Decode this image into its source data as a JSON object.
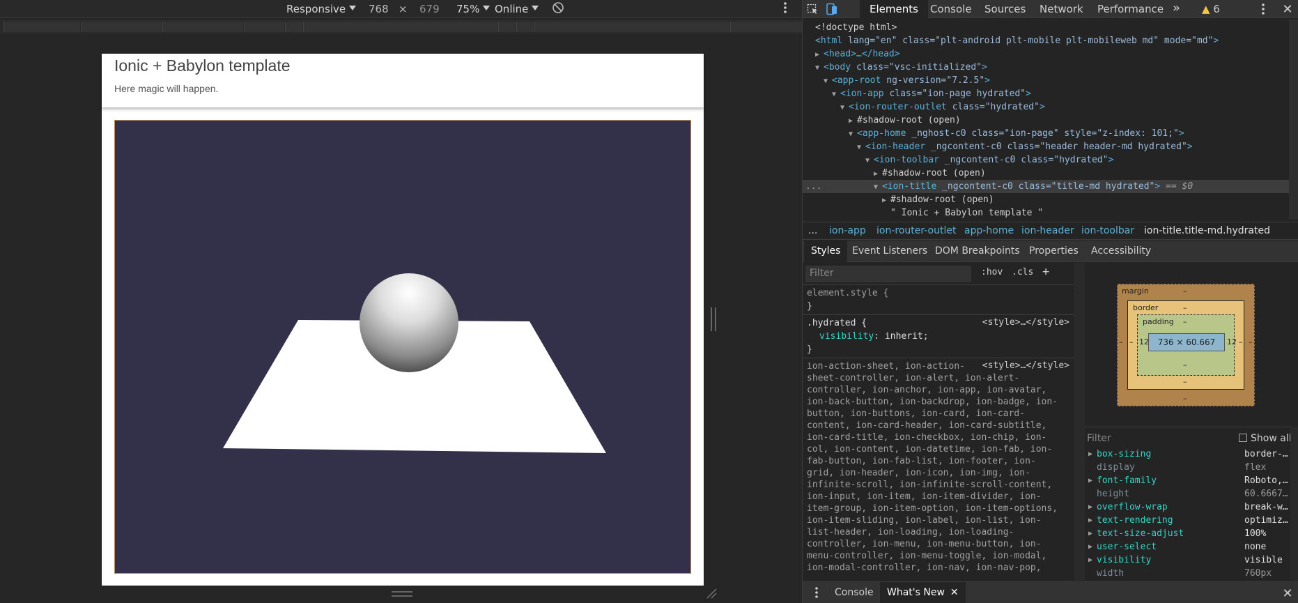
{
  "emulation": {
    "device_label": "Responsive",
    "width_value": "768",
    "times": "×",
    "height_value": "679",
    "zoom_label": "75%",
    "throttle_label": "Online"
  },
  "app": {
    "title": "Ionic + Babylon template",
    "subtitle": "Here magic will happen.",
    "canvas_bg": "#333049"
  },
  "devtools": {
    "tabs": [
      "Elements",
      "Console",
      "Sources",
      "Network",
      "Performance"
    ],
    "more_tabs": "»",
    "warning_count": "6",
    "dom_lines": [
      {
        "text": "<!doctype html>"
      },
      {
        "tag": "html",
        "attrs": "lang=\"en\" class=\"plt-android plt-mobile plt-mobileweb md\" mode=\"md\""
      },
      {
        "tag": "head",
        "text": "<head>…</head>"
      },
      {
        "tag": "body",
        "attrs": "class=\"vsc-initialized\""
      },
      {
        "tag": "app-root",
        "attrs": "ng-version=\"7.2.5\""
      },
      {
        "tag": "ion-app",
        "attrs": "class=\"ion-page hydrated\""
      },
      {
        "tag": "ion-router-outlet",
        "attrs": "class=\"hydrated\""
      },
      {
        "text": "#shadow-root (open)"
      },
      {
        "tag": "app-home",
        "attrs": "_nghost-c0 class=\"ion-page\" style=\"z-index: 101;\""
      },
      {
        "tag": "ion-header",
        "attrs": "_ngcontent-c0 class=\"header header-md hydrated\""
      },
      {
        "tag": "ion-toolbar",
        "attrs": "_ngcontent-c0 class=\"hydrated\""
      },
      {
        "text": "#shadow-root (open)"
      },
      {
        "tag": "ion-title",
        "attrs": "_ngcontent-c0 class=\"title-md hydrated\"",
        "suffix": " == $0"
      },
      {
        "text": "#shadow-root (open)"
      },
      {
        "text": "\" Ionic + Babylon template \""
      }
    ],
    "selected_ellipsis": "...",
    "breadcrumbs": [
      "...",
      "ion-app",
      "ion-router-outlet",
      "app-home",
      "ion-header",
      "ion-toolbar",
      "ion-title.title-md.hydrated"
    ],
    "sub_tabs": [
      "Styles",
      "Event Listeners",
      "DOM Breakpoints",
      "Properties",
      "Accessibility"
    ],
    "styles": {
      "filter_placeholder": "Filter",
      "hov": ":hov",
      "cls": ".cls",
      "plus": "+",
      "element_style": "element.style {",
      "close_brace": "}",
      "hydrated_selector": ".hydrated {",
      "hydrated_source": "<style>…</style>",
      "visibility_prop": "visibility",
      "visibility_val": "inherit",
      "big_selector_source": "<style>…</style>",
      "big_selector_lines": [
        "ion-action-sheet, ion-action-",
        "sheet-controller, ion-alert, ion-alert-",
        "controller, ion-anchor, ion-app, ion-avatar,",
        "ion-back-button, ion-backdrop, ion-badge, ion-",
        "button, ion-buttons, ion-card, ion-card-",
        "content, ion-card-header, ion-card-subtitle,",
        "ion-card-title, ion-checkbox, ion-chip, ion-",
        "col, ion-content, ion-datetime, ion-fab, ion-",
        "fab-button, ion-fab-list, ion-footer, ion-",
        "grid, ion-header, ion-icon, ion-img, ion-",
        "infinite-scroll, ion-infinite-scroll-content,",
        "ion-input, ion-item, ion-item-divider, ion-",
        "item-group, ion-item-option, ion-item-options,",
        "ion-item-sliding, ion-label, ion-list, ion-",
        "list-header, ion-loading, ion-loading-",
        "controller, ion-menu, ion-menu-button, ion-",
        "menu-controller, ion-menu-toggle, ion-modal,",
        "ion-modal-controller, ion-nav, ion-nav-pop,"
      ]
    },
    "box_model": {
      "margin_label": "margin",
      "margin_value": "–",
      "border_label": "border",
      "border_value": "–",
      "padding_label": "padding",
      "padding_value": "–",
      "padding_left": "12",
      "padding_right": "12",
      "content_size": "736 × 60.667",
      "dash": "–"
    },
    "computed": {
      "filter_placeholder": "Filter",
      "show_all": "Show all",
      "props": [
        {
          "name": "box-sizing",
          "value": "border-…",
          "expandable": true
        },
        {
          "name": "display",
          "value": "flex",
          "expandable": false
        },
        {
          "name": "font-family",
          "value": "Roboto,…",
          "expandable": true
        },
        {
          "name": "height",
          "value": "60.6667…",
          "expandable": false
        },
        {
          "name": "overflow-wrap",
          "value": "break-w…",
          "expandable": true
        },
        {
          "name": "text-rendering",
          "value": "optimiz…",
          "expandable": true
        },
        {
          "name": "text-size-adjust",
          "value": "100%",
          "expandable": true
        },
        {
          "name": "user-select",
          "value": "none",
          "expandable": true
        },
        {
          "name": "visibility",
          "value": "visible",
          "expandable": true
        },
        {
          "name": "width",
          "value": "760px",
          "expandable": false
        }
      ]
    },
    "drawer_tabs": [
      "Console",
      "What's New"
    ]
  }
}
